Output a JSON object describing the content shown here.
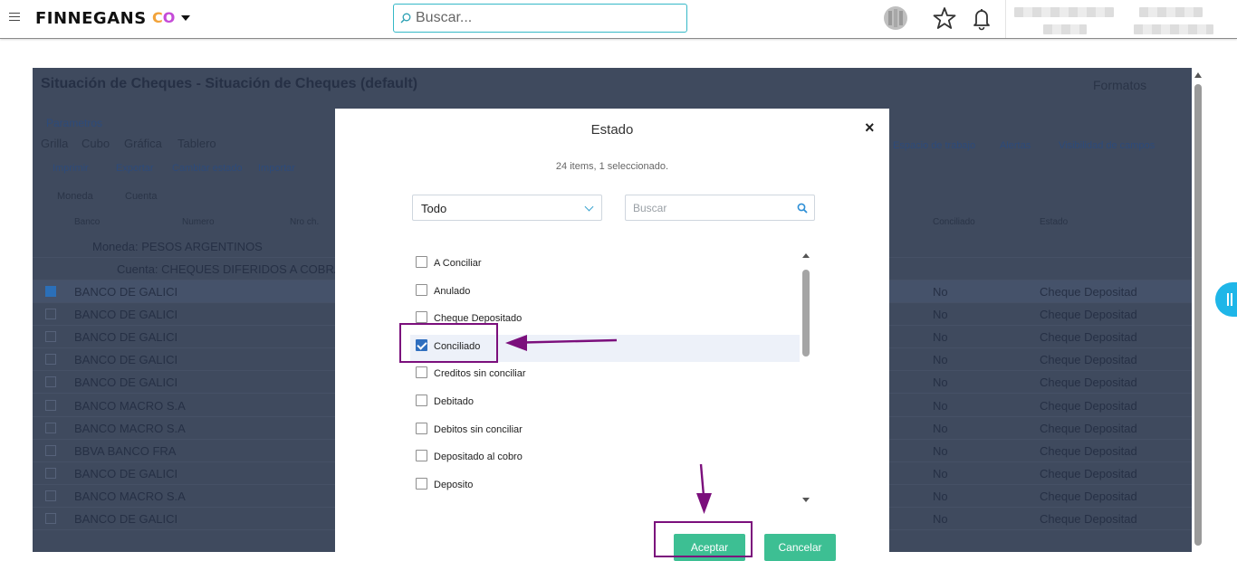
{
  "header": {
    "brand": "FINNEGANS",
    "brand_mark": [
      "C",
      "O"
    ],
    "search_placeholder": "Buscar..."
  },
  "report": {
    "title": "Situación de Cheques - Situación de Cheques (default)",
    "formats_label": "Formatos",
    "params_label": "Parametros",
    "view_tabs": [
      "Grilla",
      "Cubo",
      "Gráfica",
      "Tablero"
    ],
    "toolbar": [
      "Imprimir",
      "Exportar",
      "Cambiar estado",
      "Importar"
    ],
    "toolbar_right": [
      "Espacio de trabajo",
      "Alertas",
      "Visibilidad de campos"
    ],
    "group_chips": [
      "Moneda",
      "Cuenta"
    ],
    "columns": [
      "Banco",
      "Numero",
      "Nro ch.",
      "Conciliado",
      "Estado"
    ],
    "group_moneda": "Moneda: PESOS ARGENTINOS",
    "group_cuenta": "Cuenta: CHEQUES DIFERIDOS A COBRAR M",
    "rows": [
      {
        "banco": "BANCO DE GALICI",
        "conciliado": "No",
        "estado": "Cheque Depositad",
        "checked": true
      },
      {
        "banco": "BANCO DE GALICI",
        "conciliado": "No",
        "estado": "Cheque Depositad",
        "checked": false
      },
      {
        "banco": "BANCO DE GALICI",
        "conciliado": "No",
        "estado": "Cheque Depositad",
        "checked": false
      },
      {
        "banco": "BANCO DE GALICI",
        "conciliado": "No",
        "estado": "Cheque Depositad",
        "checked": false
      },
      {
        "banco": "BANCO DE GALICI",
        "conciliado": "No",
        "estado": "Cheque Depositad",
        "checked": false
      },
      {
        "banco": "BANCO MACRO S.A",
        "conciliado": "No",
        "estado": "Cheque Depositad",
        "checked": false
      },
      {
        "banco": "BANCO MACRO S.A",
        "conciliado": "No",
        "estado": "Cheque Depositad",
        "checked": false
      },
      {
        "banco": "BBVA BANCO FRA",
        "conciliado": "No",
        "estado": "Cheque Depositad",
        "checked": false
      },
      {
        "banco": "BANCO DE GALICI",
        "conciliado": "No",
        "estado": "Cheque Depositad",
        "checked": false
      },
      {
        "banco": "BANCO MACRO S.A",
        "conciliado": "No",
        "estado": "Cheque Depositad",
        "checked": false
      },
      {
        "banco": "BANCO DE GALICI",
        "conciliado": "No",
        "estado": "Cheque Depositad",
        "checked": false
      }
    ]
  },
  "modal": {
    "title": "Estado",
    "close": "×",
    "summary": "24 items, 1 seleccionado.",
    "filter_value": "Todo",
    "search_placeholder": "Buscar",
    "options": [
      {
        "label": "A Conciliar",
        "checked": false
      },
      {
        "label": "Anulado",
        "checked": false
      },
      {
        "label": "Cheque Depositado",
        "checked": false
      },
      {
        "label": "Conciliado",
        "checked": true
      },
      {
        "label": "Creditos sin conciliar",
        "checked": false
      },
      {
        "label": "Debitado",
        "checked": false
      },
      {
        "label": "Debitos sin conciliar",
        "checked": false
      },
      {
        "label": "Depositado al cobro",
        "checked": false
      },
      {
        "label": "Deposito",
        "checked": false
      }
    ],
    "accept_label": "Aceptar",
    "cancel_label": "Cancelar"
  },
  "colors": {
    "accent": "#35b8c7",
    "button": "#3dbf93",
    "annotation": "#7b0f7c",
    "overlay": "#3f4a5e"
  },
  "icons": [
    "menu-icon",
    "search-icon",
    "avatar-icon",
    "star-icon",
    "bell-icon",
    "close-icon",
    "chevron-down-icon"
  ]
}
